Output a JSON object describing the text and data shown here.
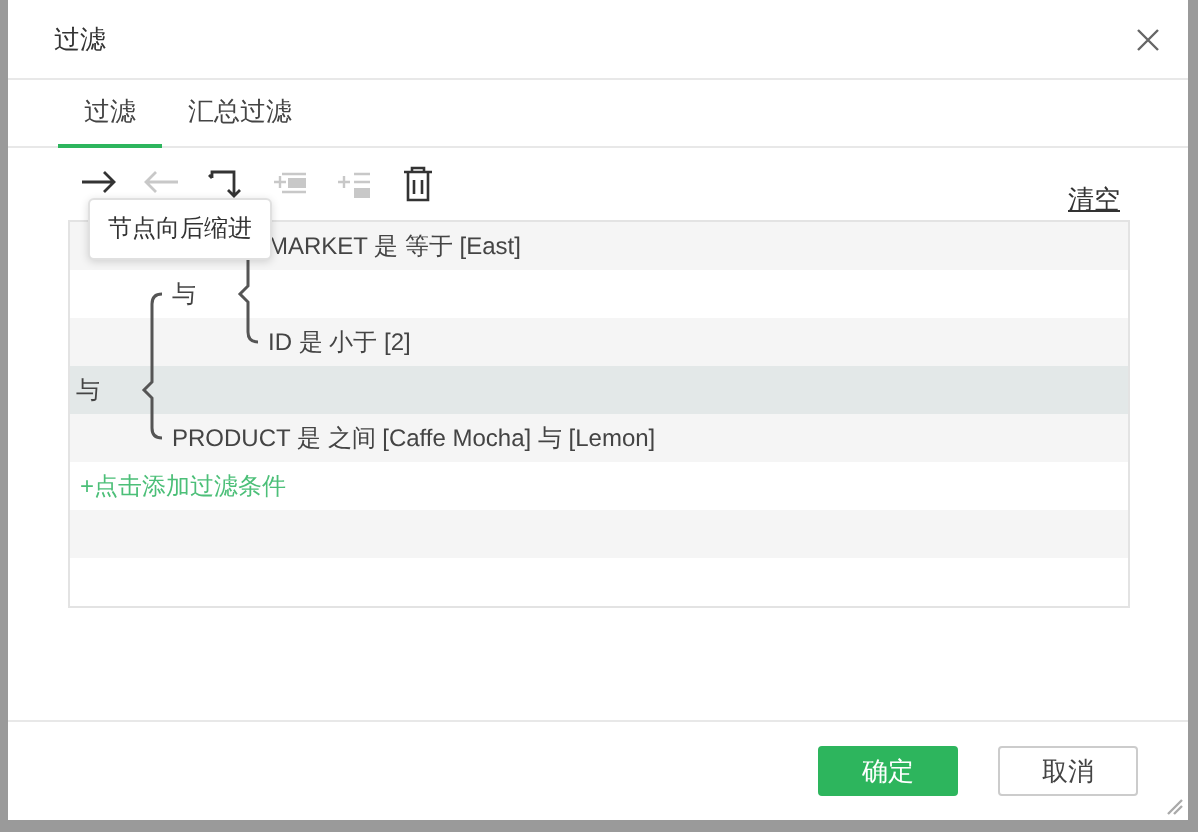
{
  "dialog": {
    "title": "过滤"
  },
  "tabs": [
    {
      "label": "过滤",
      "selected": true
    },
    {
      "label": "汇总过滤",
      "selected": false
    }
  ],
  "toolbar": {
    "tools": [
      {
        "kind": "indent",
        "disabled": false
      },
      {
        "kind": "outdent",
        "disabled": true
      },
      {
        "kind": "swap",
        "disabled": false
      },
      {
        "kind": "add-condition",
        "disabled": true
      },
      {
        "kind": "add-group",
        "disabled": true
      },
      {
        "kind": "delete",
        "disabled": false
      }
    ],
    "tooltip": "节点向后缩进",
    "clear_link": "清空"
  },
  "filter_tree": {
    "operator": "与",
    "selected": true,
    "children": [
      {
        "operator": "与",
        "selected": false,
        "children": [
          {
            "text": "MARKET 是 等于 [East]",
            "selected": false
          },
          {
            "text": "ID 是 小于 [2]",
            "selected": false
          }
        ]
      },
      {
        "text": "PRODUCT 是 之间 [Caffe Mocha] 与 [Lemon]",
        "selected": false
      }
    ]
  },
  "add_condition_link": "+点击添加过滤条件",
  "buttons": [
    {
      "label": "确定",
      "kind": "primary"
    },
    {
      "label": "取消",
      "kind": "secondary"
    }
  ]
}
